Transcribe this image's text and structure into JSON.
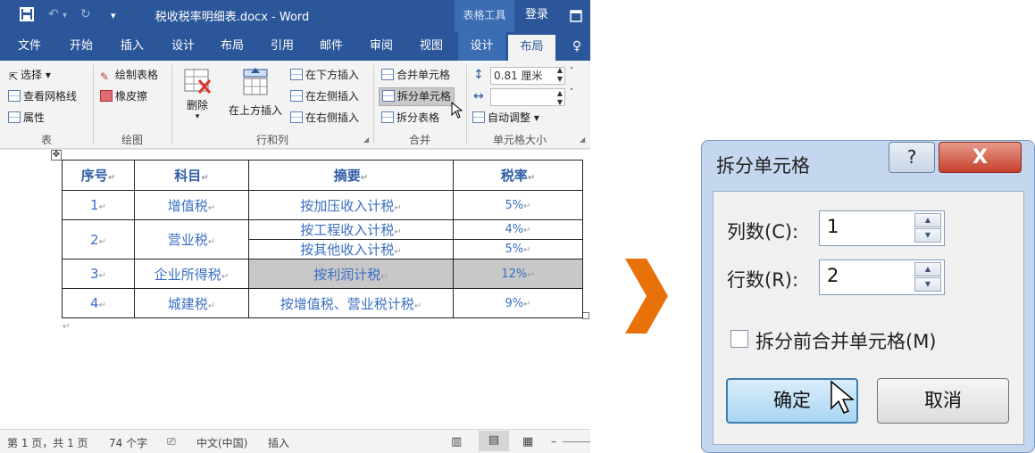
{
  "titlebar": {
    "save_icon": "save-icon",
    "undo_icon": "undo-icon",
    "redo_icon": "redo-icon",
    "customize_icon": "customize-icon",
    "title": "税收税率明细表.docx - Word",
    "context_group": "表格工具",
    "login": "登录",
    "restore_icon": "restore-icon"
  },
  "tabs": [
    "文件",
    "开始",
    "插入",
    "设计",
    "布局",
    "引用",
    "邮件",
    "审阅",
    "视图",
    "设计",
    "布局"
  ],
  "active_tab": 10,
  "ribbon": {
    "table_group": {
      "select": "选择",
      "gridlines": "查看网格线",
      "properties": "属性",
      "label": "表"
    },
    "draw_group": {
      "draw_table": "绘制表格",
      "eraser": "橡皮擦",
      "label": "绘图"
    },
    "rows_cols": {
      "delete": "删除",
      "insert_above": "在上方插入",
      "insert_below": "在下方插入",
      "insert_left": "在左侧插入",
      "insert_right": "在右侧插入",
      "label": "行和列"
    },
    "merge_group": {
      "merge_cells": "合并单元格",
      "split_cells": "拆分单元格",
      "split_table": "拆分表格",
      "label": "合并"
    },
    "cell_size": {
      "height_value": "0.81 厘米",
      "width_value": "",
      "autofit": "自动调整",
      "label": "单元格大小"
    }
  },
  "table": {
    "headers": [
      "序号",
      "科目",
      "摘要",
      "税率"
    ],
    "rows": [
      {
        "no": "1",
        "subject": "增值税",
        "summary": "按加压收入计税",
        "rate": "5%"
      },
      {
        "no": "2",
        "subject": "营业税",
        "summary": "按工程收入计税",
        "rate": "4%",
        "summary2": "按其他收入计税",
        "rate2": "5%"
      },
      {
        "no": "3",
        "subject": "企业所得税",
        "summary": "按利润计税",
        "rate": "12%"
      },
      {
        "no": "4",
        "subject": "城建税",
        "summary": "按增值税、营业税计税",
        "rate": "9%"
      }
    ],
    "para_mark": "↵"
  },
  "status": {
    "page": "第 1 页，共 1 页",
    "words": "74 个字",
    "language": "中文(中国)",
    "mode": "插入"
  },
  "dialog": {
    "title": "拆分单元格",
    "help_label": "?",
    "close_label": "X",
    "columns_label": "列数(C):",
    "columns_value": "1",
    "rows_label": "行数(R):",
    "rows_value": "2",
    "merge_before_label": "拆分前合并单元格(M)",
    "merge_before_checked": false,
    "ok_label": "确定",
    "cancel_label": "取消"
  },
  "colors": {
    "word_blue": "#2b579a",
    "arrow_orange": "#e8710a"
  }
}
